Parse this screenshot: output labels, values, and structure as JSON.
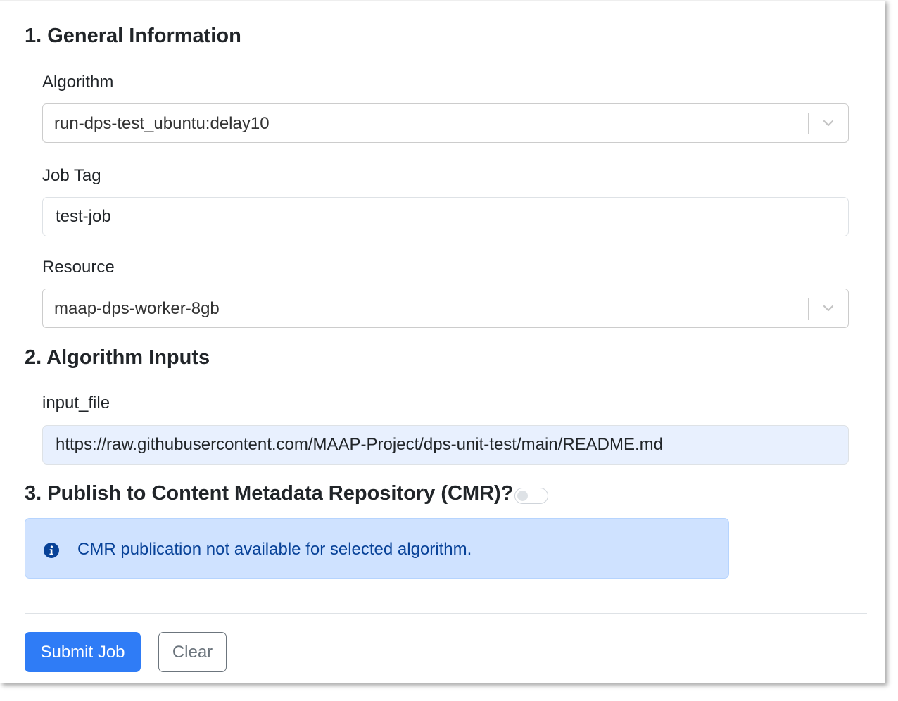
{
  "sections": {
    "general": {
      "title": "1. General Information"
    },
    "inputs": {
      "title": "2. Algorithm Inputs"
    },
    "publish": {
      "title": "3. Publish to Content Metadata Repository (CMR)?"
    }
  },
  "fields": {
    "algorithm": {
      "label": "Algorithm",
      "value": "run-dps-test_ubuntu:delay10"
    },
    "job_tag": {
      "label": "Job Tag",
      "value": "test-job"
    },
    "resource": {
      "label": "Resource",
      "value": "maap-dps-worker-8gb"
    },
    "input_file": {
      "label": "input_file",
      "value": "https://raw.githubusercontent.com/MAAP-Project/dps-unit-test/main/README.md"
    }
  },
  "publish_toggle": {
    "checked": false
  },
  "alert": {
    "icon": "info-icon",
    "message": "CMR publication not available for selected algorithm."
  },
  "buttons": {
    "submit": "Submit Job",
    "clear": "Clear"
  },
  "colors": {
    "primary": "#2f7cf6",
    "alert_bg": "#cfe2ff",
    "alert_text": "#084298",
    "autofill_bg": "#e8f0fe"
  }
}
